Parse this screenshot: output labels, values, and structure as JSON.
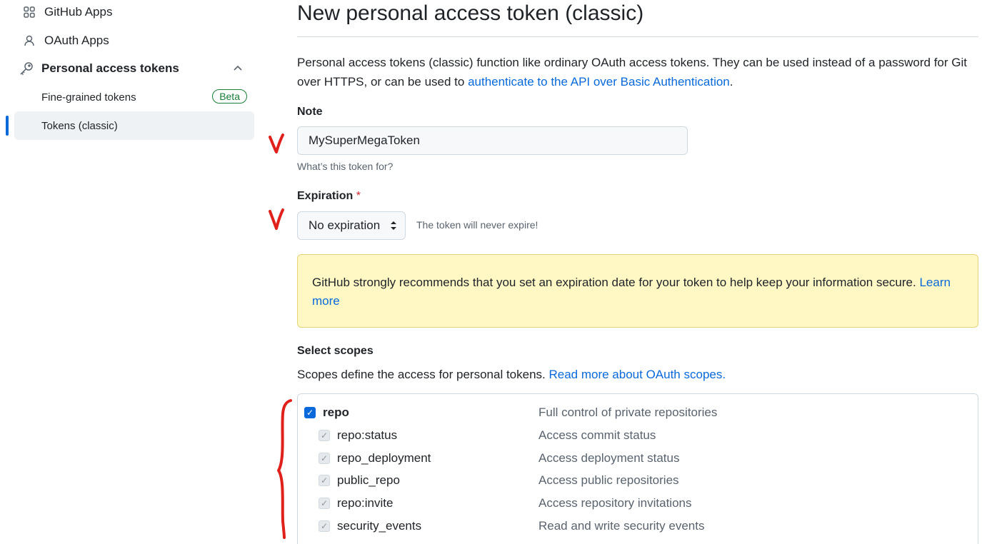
{
  "sidebar": {
    "items": [
      {
        "label": "GitHub Apps",
        "icon": "apps-icon"
      },
      {
        "label": "OAuth Apps",
        "icon": "person-icon"
      },
      {
        "label": "Personal access tokens",
        "icon": "key-icon"
      }
    ],
    "subitems": [
      {
        "label": "Fine-grained tokens",
        "badge": "Beta"
      },
      {
        "label": "Tokens (classic)",
        "active": true
      }
    ]
  },
  "page": {
    "title": "New personal access token (classic)",
    "intro_text": "Personal access tokens (classic) function like ordinary OAuth access tokens. They can be used instead of a password for Git over HTTPS, or can be used to ",
    "intro_link": "authenticate to the API over Basic Authentication",
    "intro_end": "."
  },
  "note": {
    "label": "Note",
    "value": "MySuperMegaToken",
    "help": "What’s this token for?"
  },
  "expiration": {
    "label": "Expiration",
    "required_mark": "*",
    "selected": "No expiration",
    "note": "The token will never expire!"
  },
  "warning": {
    "text": "GitHub strongly recommends that you set an expiration date for your token to help keep your information secure. ",
    "link": "Learn more"
  },
  "scopes": {
    "title": "Select scopes",
    "desc_text": "Scopes define the access for personal tokens. ",
    "desc_link": "Read more about OAuth scopes.",
    "items": [
      {
        "name": "repo",
        "desc": "Full control of private repositories",
        "checked": true,
        "main": true
      },
      {
        "name": "repo:status",
        "desc": "Access commit status",
        "checked": true
      },
      {
        "name": "repo_deployment",
        "desc": "Access deployment status",
        "checked": true
      },
      {
        "name": "public_repo",
        "desc": "Access public repositories",
        "checked": true
      },
      {
        "name": "repo:invite",
        "desc": "Access repository invitations",
        "checked": true
      },
      {
        "name": "security_events",
        "desc": "Read and write security events",
        "checked": true
      }
    ]
  },
  "colors": {
    "accent": "#0969da",
    "annotation": "#e0201b",
    "warning_bg": "#fff8c5",
    "success": "#1a7f37"
  }
}
